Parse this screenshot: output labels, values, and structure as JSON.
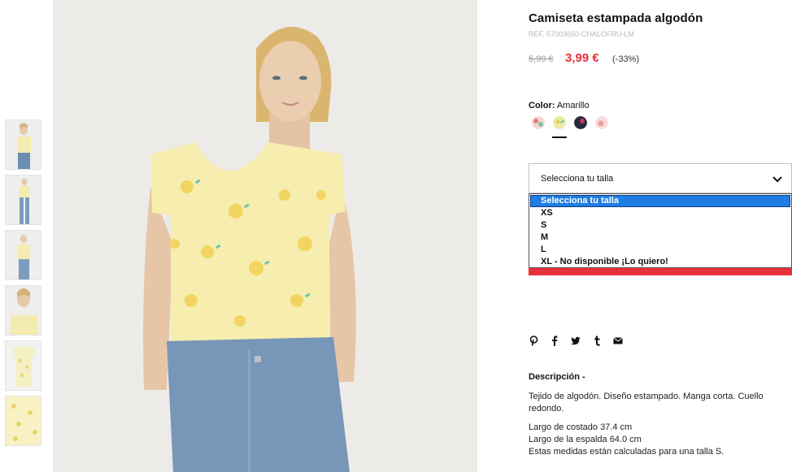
{
  "product": {
    "title": "Camiseta estampada algodón",
    "ref": "REF. 57003650-CHALOFRU-LM",
    "price_old": "5,99 €",
    "price_new": "3,99 €",
    "discount": "(-33%)"
  },
  "color": {
    "label": "Color:",
    "value": "Amarillo",
    "swatches": [
      {
        "name": "floral-print",
        "hex": "#e8a0a0"
      },
      {
        "name": "yellow-lemon",
        "hex": "#efe7a8"
      },
      {
        "name": "navy-print",
        "hex": "#2a2a3e"
      },
      {
        "name": "pink-print",
        "hex": "#f1c2c2"
      }
    ],
    "selected_index": 1
  },
  "size": {
    "select_label": "Selecciona tu talla",
    "options": [
      "Selecciona tu talla",
      "XS",
      "S",
      "M",
      "L",
      "XL - No disponible ¡Lo quiero!"
    ],
    "highlighted_index": 0
  },
  "social": [
    "pinterest-icon",
    "facebook-icon",
    "twitter-icon",
    "tumblr-icon",
    "email-icon"
  ],
  "description": {
    "title": "Descripción -",
    "text": "Tejido de algodón. Diseño estampado. Manga corta. Cuello redondo.",
    "measure_1": "Largo de costado 37.4 cm",
    "measure_2": "Largo de la espalda 64.0 cm",
    "measure_note": "Estas medidas están calculadas para una talla S."
  },
  "colors": {
    "accent": "#e8303b",
    "highlight": "#1e7de0"
  }
}
